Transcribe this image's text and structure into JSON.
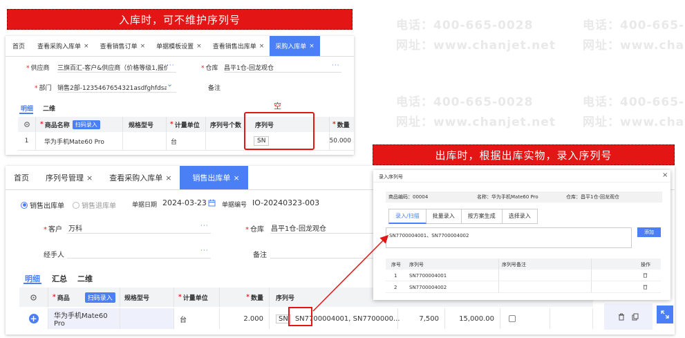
{
  "watermark": {
    "phone": "电话：400-665-0028",
    "site": "网址：www.chanjet.net"
  },
  "banner_top": "入库时，可不维护序列号",
  "banner_right": "出库时，根据出库实物，录入序列号",
  "empty_label": "空",
  "purchase": {
    "tabs": [
      {
        "label": "首页",
        "closable": false
      },
      {
        "label": "查看采购入库单",
        "closable": true
      },
      {
        "label": "查看销售订单",
        "closable": true
      },
      {
        "label": "单据模板设置",
        "closable": true
      },
      {
        "label": "查看销售出库单",
        "closable": true
      },
      {
        "label": "采购入库单",
        "closable": true
      }
    ],
    "close_glyph": "×",
    "supplier_label": "供应商",
    "supplier_value": "三旗百汇-客户&供应商（价格等级1,报价含税...",
    "dept_label": "部门",
    "dept_value": "销售2部-1235467654321asdfghfdsasdfghd...",
    "warehouse_label": "仓库",
    "warehouse_value": "昌平1仓-回龙观仓",
    "remark_label": "备注",
    "more_glyph": "···",
    "chevron_glyph": "⌄",
    "subtabs": [
      "明细",
      "二维"
    ],
    "headers": [
      "商品名称",
      "扫码录入",
      "规格型号",
      "计量单位",
      "序列号个数",
      "序列号",
      "数量"
    ],
    "row": {
      "index": "1",
      "product": "华为手机Mate60 Pro",
      "spec": "",
      "unit": "台",
      "sn_count": "",
      "sn": "SN",
      "qty": "50.000"
    }
  },
  "sales": {
    "tabs": [
      {
        "label": "首页",
        "closable": false
      },
      {
        "label": "序列号管理",
        "closable": true
      },
      {
        "label": "查看采购入库单",
        "closable": true
      },
      {
        "label": "销售出库单",
        "closable": true
      }
    ],
    "close_glyph": "×",
    "radio_outbound": "销售出库单",
    "radio_return": "销售退库单",
    "date_label": "单据日期",
    "date_value": "2024-03-23",
    "code_label": "单据编号",
    "code_value": "IO-20240323-003",
    "customer_label": "客户",
    "customer_value": "万科",
    "warehouse_label": "仓库",
    "warehouse_value": "昌平1仓-回龙观仓",
    "handler_label": "经手人",
    "remark_label": "备注",
    "more_glyph": "···",
    "subtabs": [
      "明细",
      "汇总",
      "二维"
    ],
    "headers": [
      "商品",
      "扫码录入",
      "规格型号",
      "计量单位",
      "数量",
      "序列号"
    ],
    "row": {
      "product": "华为手机Mate60 Pro",
      "unit": "台",
      "qty": "2.000",
      "sn_tag": "SN",
      "sn_value": "SN7700004001, SN7700000...",
      "price": "7,500",
      "amount": "15,000.00"
    },
    "add_glyph": "+"
  },
  "dialog": {
    "title": "录入序列号",
    "close_glyph": "×",
    "code_label": "商品编码：",
    "code_value": "00004",
    "name_label": "名称：",
    "name_value": "华为手机Mate60 Pro",
    "warehouse_label": "仓库：",
    "warehouse_value": "昌平1仓-回龙观仓",
    "tabs": [
      "录入/扫描",
      "批量录入",
      "按方案生成",
      "选择录入"
    ],
    "input_value": "SN7700004001、SN7700004002",
    "add_button": "添加",
    "headers": [
      "序号",
      "序列号",
      "序列号备注",
      "操作"
    ],
    "rows": [
      {
        "index": "1",
        "sn": "SN7700004001",
        "note": ""
      },
      {
        "index": "2",
        "sn": "SN7700004002",
        "note": ""
      }
    ]
  },
  "colors": {
    "accent": "#4a7ff5",
    "banner": "#e31515",
    "required": "#e02020"
  }
}
